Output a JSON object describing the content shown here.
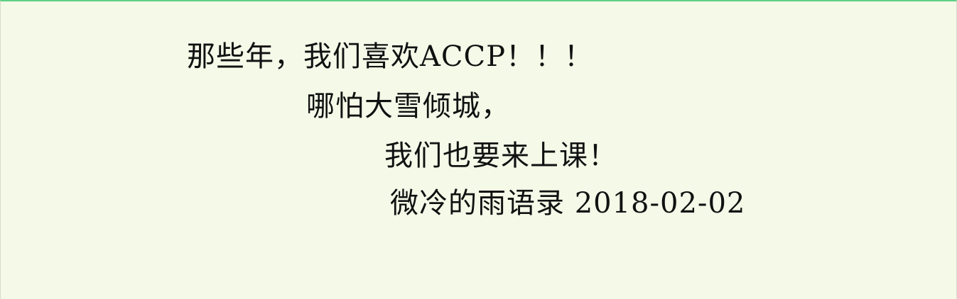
{
  "content": {
    "line1": "那些年，我们喜欢ACCP！！！",
    "line2": "哪怕大雪倾城，",
    "line3": "我们也要来上课！",
    "line4": "微冷的雨语录 2018-02-02"
  },
  "colors": {
    "background": "#f4f9e8",
    "text": "#111111",
    "top_border": "#5fcf86"
  }
}
